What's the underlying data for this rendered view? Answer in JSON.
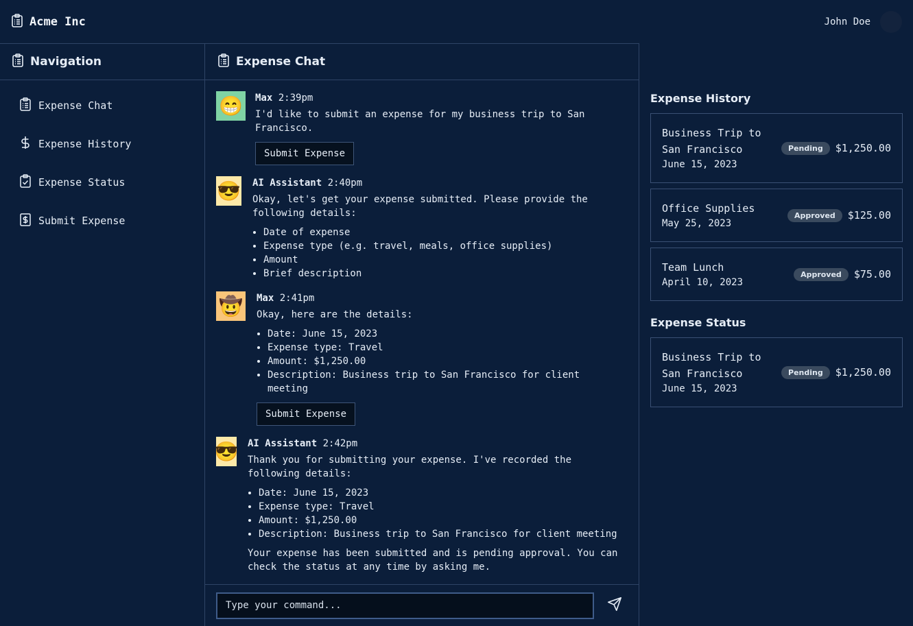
{
  "header": {
    "brand": "Acme Inc",
    "user_name": "John Doe"
  },
  "sidebar": {
    "title": "Navigation",
    "items": [
      {
        "label": "Expense Chat",
        "icon": "clipboard-icon"
      },
      {
        "label": "Expense History",
        "icon": "dollar-icon"
      },
      {
        "label": "Expense Status",
        "icon": "clipboard-check-icon"
      },
      {
        "label": "Submit Expense",
        "icon": "receipt-dollar-icon"
      }
    ]
  },
  "chat": {
    "title": "Expense Chat",
    "messages": [
      {
        "author": "Max",
        "time": "2:39pm",
        "avatar": "😁",
        "text": "I'd like to submit an expense for my business trip to San Francisco.",
        "button": "Submit Expense"
      },
      {
        "author": "AI Assistant",
        "time": "2:40pm",
        "avatar": "😎",
        "text": "Okay, let's get your expense submitted. Please provide the following details:",
        "list": [
          "Date of expense",
          "Expense type (e.g. travel, meals, office supplies)",
          "Amount",
          "Brief description"
        ]
      },
      {
        "author": "Max",
        "time": "2:41pm",
        "avatar": "🤠",
        "text": "Okay, here are the details:",
        "list": [
          "Date: June 15, 2023",
          "Expense type: Travel",
          "Amount: $1,250.00",
          "Description: Business trip to San Francisco for client meeting"
        ],
        "button": "Submit Expense"
      },
      {
        "author": "AI Assistant",
        "time": "2:42pm",
        "avatar": "😎",
        "text": "Thank you for submitting your expense. I've recorded the following details:",
        "list": [
          "Date: June 15, 2023",
          "Expense type: Travel",
          "Amount: $1,250.00",
          "Description: Business trip to San Francisco for client meeting"
        ],
        "after": "Your expense has been submitted and is pending approval. You can check the status at any time by asking me."
      }
    ],
    "composer": {
      "placeholder": "Type your command..."
    }
  },
  "history": {
    "title": "Expense History",
    "items": [
      {
        "title": "Business Trip to San Francisco",
        "date": "June 15, 2023",
        "status": "Pending",
        "amount": "$1,250.00"
      },
      {
        "title": "Office Supplies",
        "date": "May 25, 2023",
        "status": "Approved",
        "amount": "$125.00"
      },
      {
        "title": "Team Lunch",
        "date": "April 10, 2023",
        "status": "Approved",
        "amount": "$75.00"
      }
    ]
  },
  "status": {
    "title": "Expense Status",
    "items": [
      {
        "title": "Business Trip to San Francisco",
        "date": "June 15, 2023",
        "status": "Pending",
        "amount": "$1,250.00"
      }
    ]
  },
  "colors": {
    "background": "#0b1e3a",
    "border": "#2f4466",
    "badge": "#3a4a5e"
  }
}
